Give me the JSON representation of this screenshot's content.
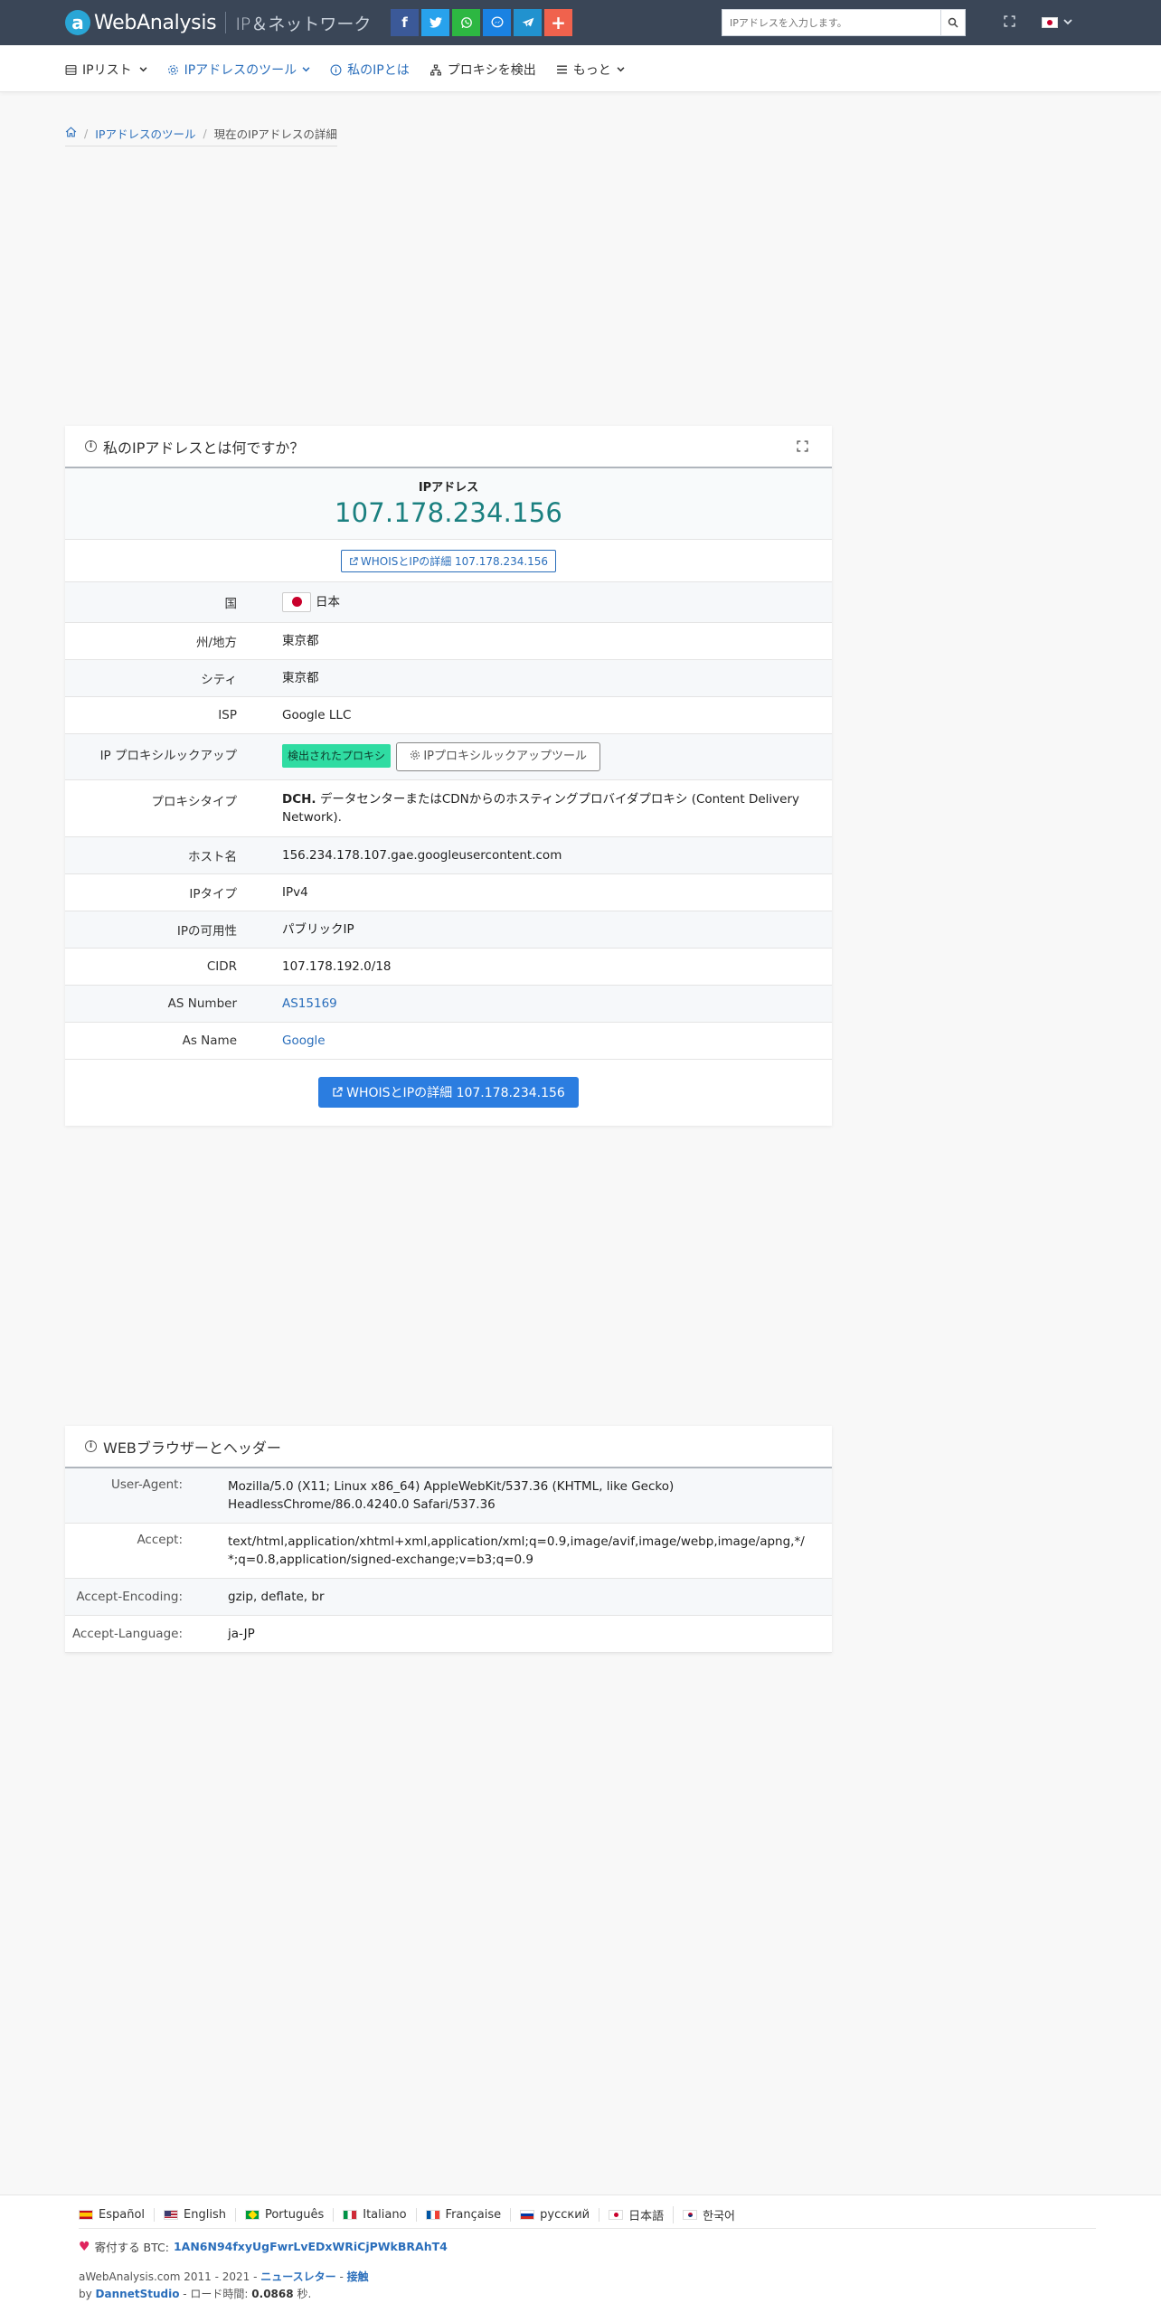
{
  "header": {
    "brand_letter": "a",
    "brand_name": "WebAnalysis",
    "tagline": "IP＆ネットワーク",
    "share_icons": [
      "facebook-icon",
      "twitter-icon",
      "whatsapp-icon",
      "messenger-icon",
      "telegram-icon",
      "plus-icon"
    ],
    "search_placeholder": "IPアドレスを入力します。",
    "share_colors": {
      "facebook": "#3b5998",
      "twitter": "#28a2ec",
      "whatsapp": "#2db742",
      "messenger": "#1a82e2",
      "telegram": "#2192cf",
      "plus": "#f0624d"
    }
  },
  "nav": {
    "items": [
      {
        "label": "IPリスト",
        "icon": "server-icon",
        "has_caret": true,
        "active": false
      },
      {
        "label": "IPアドレスのツール",
        "icon": "gear-icon",
        "has_caret": true,
        "active": true
      },
      {
        "label": "私のIPとは",
        "icon": "info-icon",
        "has_caret": false,
        "active": true
      },
      {
        "label": "プロキシを検出",
        "icon": "sitemap-icon",
        "has_caret": false,
        "active": false
      },
      {
        "label": "もっと",
        "icon": "menu-icon",
        "has_caret": true,
        "active": false
      }
    ]
  },
  "breadcrumb": {
    "items": [
      "IPアドレスのツール",
      "現在のIPアドレスの詳細"
    ]
  },
  "ip_card": {
    "title": "私のIPアドレスとは何ですか？",
    "ip_label": "IPアドレス",
    "ip_value": "107.178.234.156",
    "whois_small": "WHOISとIPの詳細 107.178.234.156",
    "rows": {
      "country_key": "国",
      "country_val": "日本",
      "region_key": "州/地方",
      "region_val": "東京都",
      "city_key": "シティ",
      "city_val": "東京都",
      "isp_key": "ISP",
      "isp_val": "Google LLC",
      "proxy_lookup_key": "IP プロキシルックアップ",
      "proxy_badge": "検出されたプロキシ",
      "proxy_tool_btn": "IPプロキシルックアップツール",
      "proxy_type_key": "プロキシタイプ",
      "proxy_type_code": "DCH.",
      "proxy_type_desc": " データセンターまたはCDNからのホスティングプロバイダプロキシ (Content Delivery Network).",
      "hostname_key": "ホスト名",
      "hostname_val": "156.234.178.107.gae.googleusercontent.com",
      "iptype_key": "IPタイプ",
      "iptype_val": "IPv4",
      "avail_key": "IPの可用性",
      "avail_val": "パブリックIP",
      "cidr_key": "CIDR",
      "cidr_val": "107.178.192.0/18",
      "asn_key": "AS Number",
      "asn_val": "AS15169",
      "asname_key": "As Name",
      "asname_val": "Google"
    },
    "whois_big": "WHOISとIPの詳細 107.178.234.156"
  },
  "browser_card": {
    "title": "WEBブラウザーとヘッダー",
    "rows": {
      "ua_key": "User-Agent:",
      "ua_val": "Mozilla/5.0 (X11; Linux x86_64) AppleWebKit/537.36 (KHTML, like Gecko) HeadlessChrome/86.0.4240.0 Safari/537.36",
      "accept_key": "Accept:",
      "accept_val": "text/html,application/xhtml+xml,application/xml;q=0.9,image/avif,image/webp,image/apng,*/*;q=0.8,application/signed-exchange;v=b3;q=0.9",
      "enc_key": "Accept-Encoding:",
      "enc_val": "gzip, deflate, br",
      "lang_key": "Accept-Language:",
      "lang_val": "ja-JP"
    }
  },
  "footer": {
    "languages": [
      "Español",
      "English",
      "Português",
      "Italiano",
      "Française",
      "русский",
      "日本語",
      "한국어"
    ],
    "donate_label": "寄付する BTC:",
    "btc_address": "1AN6N94fxyUgFwrLvEDxWRiCjPWkBRAhT4",
    "copyright": "aWebAnalysis.com 2011 - 2021 -",
    "newsletter": "ニュースレター",
    "dash": "-",
    "contact": "接触",
    "by": "by",
    "studio": "DannetStudio",
    "load_label": "- ロード時間:",
    "load_time": "0.0868",
    "seconds": "秒."
  }
}
